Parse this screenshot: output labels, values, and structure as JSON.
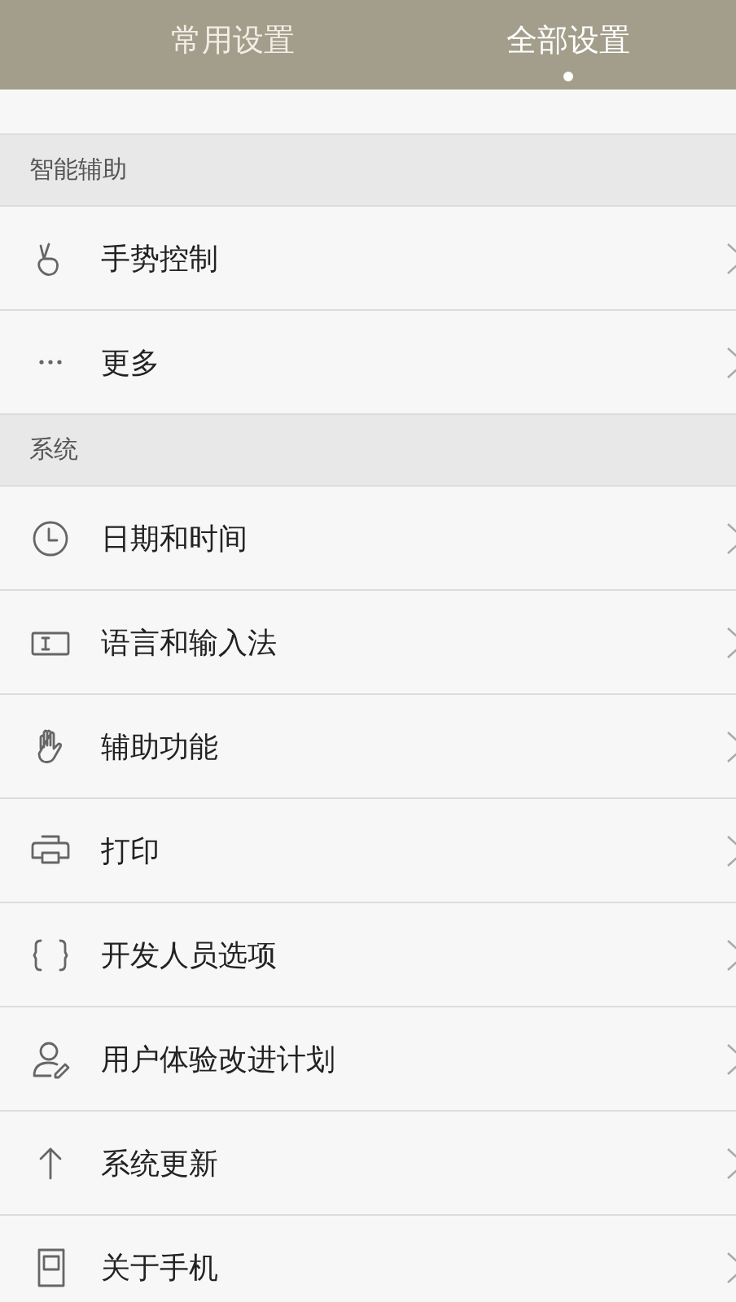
{
  "tabs": [
    {
      "label": "常用设置",
      "selected": false
    },
    {
      "label": "全部设置",
      "selected": true
    }
  ],
  "sections": [
    {
      "title": "智能辅助",
      "items": [
        {
          "label": "手势控制",
          "kind": "gesture"
        },
        {
          "label": "更多",
          "kind": "dots"
        }
      ]
    },
    {
      "title": "系统",
      "items": [
        {
          "label": "日期和时间",
          "kind": "clock"
        },
        {
          "label": "语言和输入法",
          "kind": "keyboard"
        },
        {
          "label": "辅助功能",
          "kind": "hand"
        },
        {
          "label": "打印",
          "kind": "printer"
        },
        {
          "label": "开发人员选项",
          "kind": "braces"
        },
        {
          "label": "用户体验改进计划",
          "kind": "user"
        },
        {
          "label": "系统更新",
          "kind": "arrow"
        },
        {
          "label": "关于手机",
          "kind": "phone"
        }
      ]
    }
  ]
}
